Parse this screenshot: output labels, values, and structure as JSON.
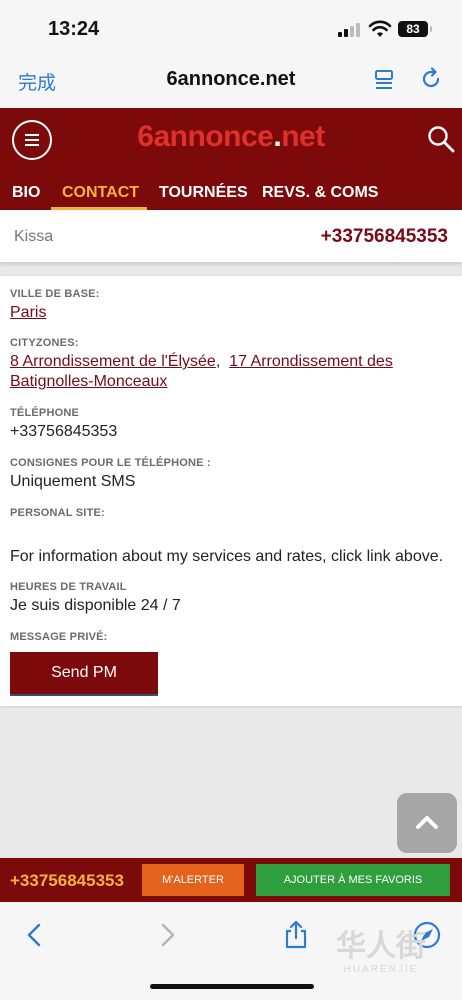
{
  "status_bar": {
    "time": "13:24",
    "battery": "83"
  },
  "browser": {
    "done_label": "完成",
    "domain": "6annonce.net"
  },
  "site": {
    "logo_prefix": "6annonce",
    "logo_dot": ".",
    "logo_suffix": "net",
    "tabs": [
      {
        "label": "BIO",
        "active": false
      },
      {
        "label": "CONTACT",
        "active": true
      },
      {
        "label": "TOURNÉES",
        "active": false
      },
      {
        "label": "REVS. & COMS",
        "active": false
      }
    ]
  },
  "contact_strip": {
    "name": "Kissa",
    "phone": "+33756845353"
  },
  "details": {
    "base_city_label": "VILLE DE BASE:",
    "base_city": "Paris",
    "cityzones_label": "CITYZONES:",
    "cityzone_1": "8 Arrondissement de l'Élysée",
    "cityzone_sep": ",",
    "cityzone_2": "17 Arrondissement des Batignolles-Monceaux",
    "phone_label": "TÉLÉPHONE",
    "phone": "+33756845353",
    "phone_instructions_label": "CONSIGNES POUR LE TÉLÉPHONE :",
    "phone_instructions": "Uniquement SMS",
    "personal_site_label": "PERSONAL SITE:",
    "personal_site_text": "For information about my services and rates, click link above.",
    "hours_label": "HEURES DE TRAVAIL",
    "hours": "Je suis disponible 24 / 7",
    "private_message_label": "MESSAGE PRIVÉ:",
    "send_pm_label": "Send PM"
  },
  "bottom_bar": {
    "phone": "+33756845353",
    "alert_label": "M'ALERTER",
    "favorites_label": "AJOUTER À MES FAVORIS"
  },
  "watermark": {
    "cn": "华人街",
    "en": "HUARENJIE"
  },
  "colors": {
    "brand_red": "#7d0a0a",
    "accent": "#f3b33d",
    "link": "#7a0a16",
    "alert_orange": "#e4621c",
    "favorites_green": "#2f9e3c",
    "ios_blue": "#2f7ad1"
  }
}
